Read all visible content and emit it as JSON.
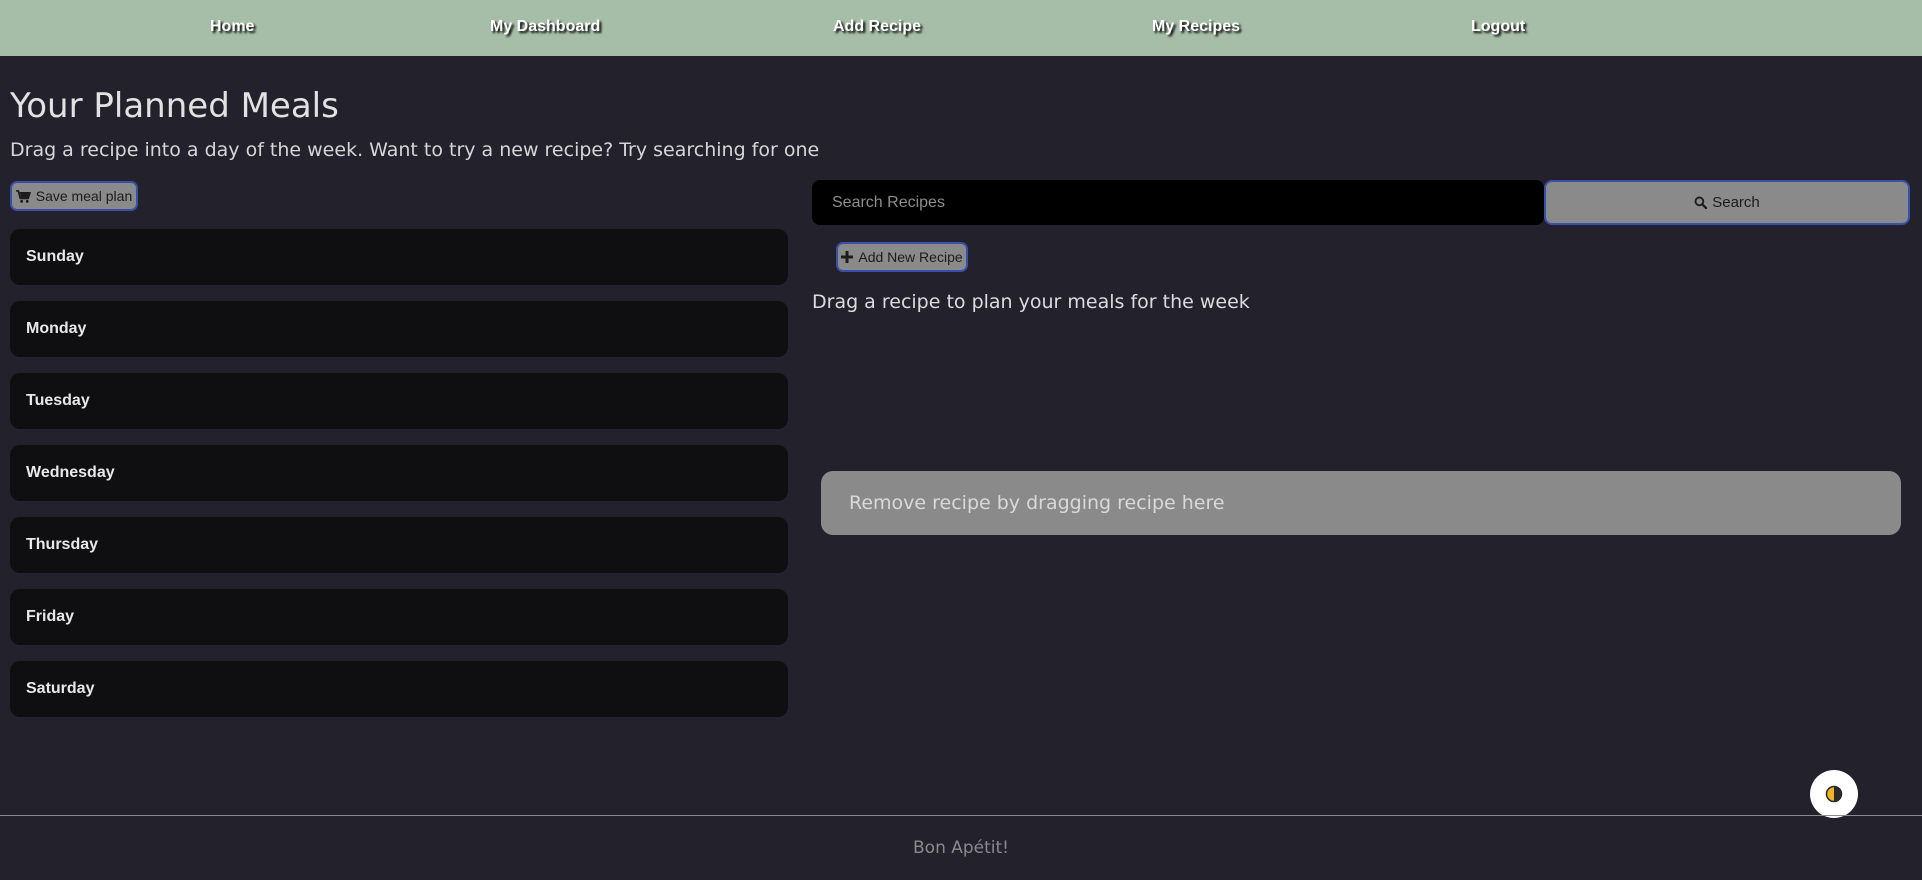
{
  "nav": {
    "items": [
      {
        "label": "Home"
      },
      {
        "label": "My Dashboard"
      },
      {
        "label": "Add Recipe"
      },
      {
        "label": "My Recipes"
      },
      {
        "label": "Logout"
      }
    ]
  },
  "page": {
    "title": "Your Planned Meals",
    "subtitle": "Drag a recipe into a day of the week. Want to try a new recipe? Try searching for one"
  },
  "plan": {
    "save_label": "Save meal plan",
    "save_icon": "shopping-cart-icon",
    "days": [
      "Sunday",
      "Monday",
      "Tuesday",
      "Wednesday",
      "Thursday",
      "Friday",
      "Saturday"
    ]
  },
  "search": {
    "placeholder": "Search Recipes",
    "value": "",
    "button_label": "Search",
    "button_icon": "search-icon"
  },
  "recipes": {
    "add_label": "Add New Recipe",
    "add_icon": "plus-icon",
    "drag_hint": "Drag a recipe to plan your meals for the week",
    "remove_zone_label": "Remove recipe by dragging recipe here"
  },
  "theme_toggle": {
    "icon": "contrast-icon"
  },
  "footer": {
    "text": "Bon Apétit!"
  },
  "colors": {
    "nav_bg": "#a6bea7",
    "page_bg": "#22212c",
    "day_bg": "#0f0f12",
    "button_bg": "#8a8a8a",
    "button_border": "#3a4fa8",
    "toggle_accent": "#f0b429"
  }
}
